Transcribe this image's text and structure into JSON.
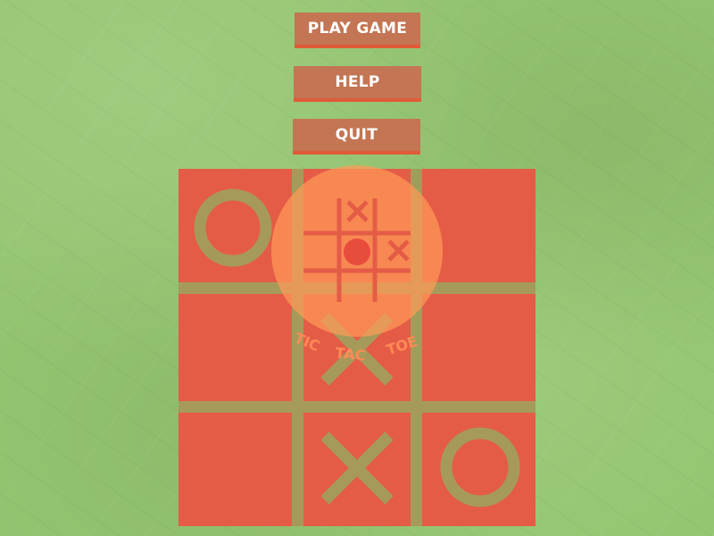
{
  "menu": {
    "play_label": "PLAY GAME",
    "help_label": "HELP",
    "quit_label": "QUIT"
  },
  "logo": {
    "word1": "TIC",
    "word2": "TAC",
    "word3": "TOE"
  },
  "board": {
    "cells": [
      [
        "O",
        "",
        ""
      ],
      [
        "",
        "X",
        ""
      ],
      [
        "",
        "X",
        "O"
      ]
    ]
  },
  "colors": {
    "background": "#94c671",
    "button": "#c47553",
    "button_shadow": "#e05a3a",
    "cell": "#e45c46",
    "grid": "#a69a5a",
    "mark": "#a69a5a",
    "logo_circle": "#ff9a57"
  },
  "icons": {
    "logo": "tic-tac-toe-logo-icon",
    "x_mark": "x-mark-icon",
    "o_mark": "o-mark-icon"
  }
}
